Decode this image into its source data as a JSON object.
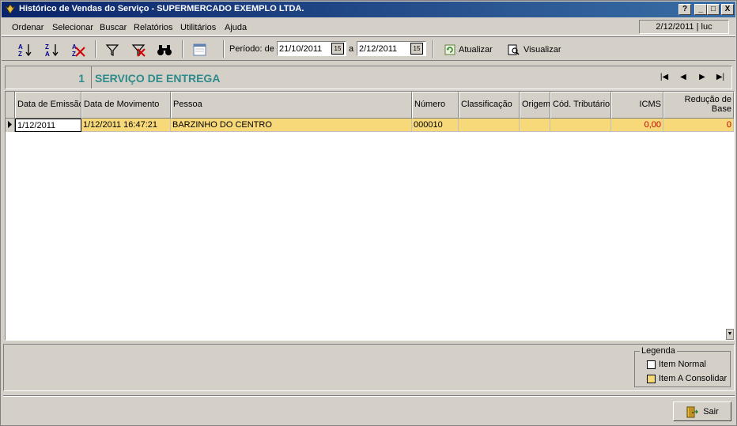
{
  "window": {
    "title": "Histórico de Vendas do Serviço - SUPERMERCADO EXEMPLO LTDA.",
    "help_btn": "?",
    "minimize_btn": "_",
    "maximize_btn": "□",
    "close_btn": "X"
  },
  "menu": {
    "items": [
      {
        "label": "Ordenar"
      },
      {
        "label": "Selecionar"
      },
      {
        "label": "Buscar"
      },
      {
        "label": "Relatórios"
      },
      {
        "label": "Utilitários"
      },
      {
        "label": "Ajuda"
      }
    ],
    "status": "2/12/2011 | luc"
  },
  "toolbar": {
    "icons": [
      "sort-asc-icon",
      "sort-desc-icon",
      "clear-sort-icon",
      "filter-icon",
      "clear-filter-icon",
      "binoculars-icon",
      "window-icon"
    ],
    "periodo_label": "Período: de",
    "date_from": "21/10/2011",
    "a_label": "a",
    "date_to": "2/12/2011",
    "calendar_glyph": "15",
    "atualizar_label": "Atualizar",
    "visualizar_label": "Visualizar"
  },
  "service": {
    "number": "1",
    "name": "SERVIÇO DE ENTREGA"
  },
  "nav": {
    "first": "|◀",
    "prev": "◀",
    "next": "▶",
    "last": "▶|"
  },
  "table": {
    "columns": [
      {
        "label": "Data de Emissão"
      },
      {
        "label": "Data de Movimento"
      },
      {
        "label": "Pessoa"
      },
      {
        "label": "Número"
      },
      {
        "label": "Classificação"
      },
      {
        "label": "Origem"
      },
      {
        "label": "Cód. Tributário"
      },
      {
        "label": "ICMS"
      },
      {
        "label": "Redução de Base"
      }
    ],
    "rows": [
      {
        "data_emissao": "1/12/2011",
        "data_movimento": "1/12/2011 16:47:21",
        "pessoa": "BARZINHO DO CENTRO",
        "numero": "000010",
        "classificacao": "",
        "origem": "",
        "cod_tributario": "",
        "icms": "0,00",
        "reducao_base": "0"
      }
    ]
  },
  "legend": {
    "title": "Legenda",
    "items": [
      {
        "label": "Item Normal",
        "color": "#ffffff"
      },
      {
        "label": "Item A Consolidar",
        "color": "#f7d97a"
      }
    ]
  },
  "footer": {
    "sair_label": "Sair"
  },
  "colors": {
    "accent_teal": "#2e8b8b",
    "row_highlight": "#f7d97a",
    "value_red": "#c00000"
  }
}
